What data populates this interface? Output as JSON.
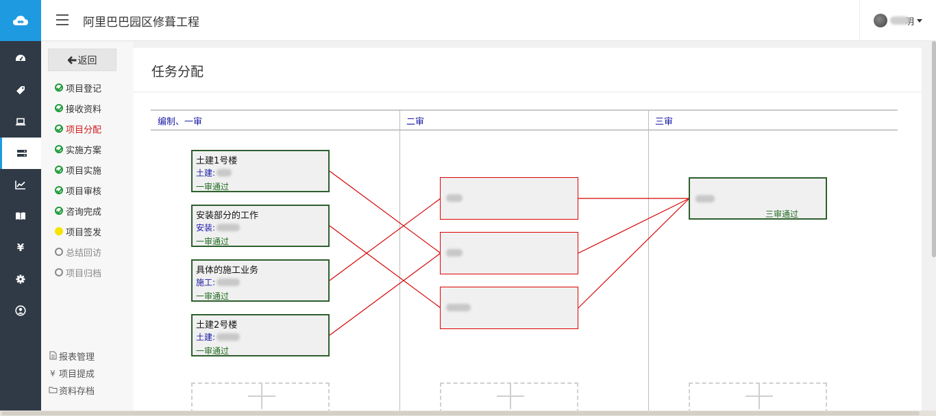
{
  "header": {
    "app_title": "阿里巴巴园区修葺工程",
    "user_name_tail": "明"
  },
  "rail": {
    "items": [
      {
        "icon": "dashboard-icon"
      },
      {
        "icon": "tag-icon"
      },
      {
        "icon": "laptop-icon"
      },
      {
        "icon": "server-icon",
        "active": true
      },
      {
        "icon": "line-chart-icon"
      },
      {
        "icon": "book-icon"
      },
      {
        "icon": "yen-icon",
        "glyph": "¥"
      },
      {
        "icon": "gear-icon"
      },
      {
        "icon": "user-circle-icon"
      }
    ]
  },
  "sub_menu": {
    "back_label": "返回",
    "steps": [
      {
        "label": "项目登记",
        "state": "done"
      },
      {
        "label": "接收资料",
        "state": "done"
      },
      {
        "label": "项目分配",
        "state": "current"
      },
      {
        "label": "实施方案",
        "state": "done"
      },
      {
        "label": "项目实施",
        "state": "done"
      },
      {
        "label": "项目审核",
        "state": "done"
      },
      {
        "label": "咨询完成",
        "state": "done"
      },
      {
        "label": "项目签发",
        "state": "pending"
      },
      {
        "label": "总结回访",
        "state": "todo"
      },
      {
        "label": "项目归档",
        "state": "todo"
      }
    ],
    "tools": [
      {
        "icon": "file-icon",
        "label": "报表管理"
      },
      {
        "icon": "yen-icon",
        "glyph": "¥",
        "label": "项目提成"
      },
      {
        "icon": "folder-icon",
        "label": "资料存档"
      }
    ]
  },
  "panel": {
    "title": "任务分配",
    "columns": [
      {
        "label": "编制、一审"
      },
      {
        "label": "二审"
      },
      {
        "label": "三审"
      }
    ],
    "first_stage_cards": [
      {
        "title": "土建1号楼",
        "role": "土建:",
        "status": "一审通过"
      },
      {
        "title": "安装部分的工作",
        "role": "安装:",
        "status": "一审通过"
      },
      {
        "title": "具体的施工业务",
        "role": "施工:",
        "status": "一审通过"
      },
      {
        "title": "土建2号楼",
        "role": "土建:",
        "status": "一审通过"
      }
    ],
    "third_stage_card": {
      "status": "三审通过"
    }
  },
  "colors": {
    "accent": "#1e9ae0",
    "rail_bg": "#2f3a46",
    "approved_border": "#2d5e2d",
    "pending_border": "#e00000",
    "link_line": "#d40000",
    "column_header_text": "#1a1aa6"
  }
}
